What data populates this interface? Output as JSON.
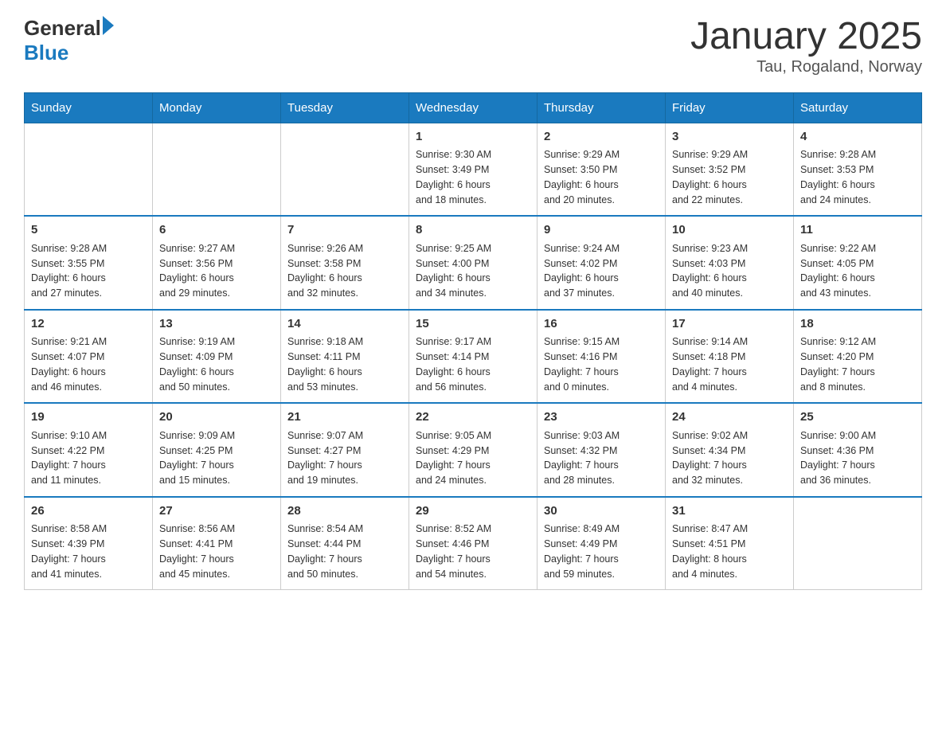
{
  "header": {
    "logo_general": "General",
    "logo_blue": "Blue",
    "month_title": "January 2025",
    "location": "Tau, Rogaland, Norway"
  },
  "days_of_week": [
    "Sunday",
    "Monday",
    "Tuesday",
    "Wednesday",
    "Thursday",
    "Friday",
    "Saturday"
  ],
  "weeks": [
    [
      {
        "day": "",
        "info": ""
      },
      {
        "day": "",
        "info": ""
      },
      {
        "day": "",
        "info": ""
      },
      {
        "day": "1",
        "info": "Sunrise: 9:30 AM\nSunset: 3:49 PM\nDaylight: 6 hours\nand 18 minutes."
      },
      {
        "day": "2",
        "info": "Sunrise: 9:29 AM\nSunset: 3:50 PM\nDaylight: 6 hours\nand 20 minutes."
      },
      {
        "day": "3",
        "info": "Sunrise: 9:29 AM\nSunset: 3:52 PM\nDaylight: 6 hours\nand 22 minutes."
      },
      {
        "day": "4",
        "info": "Sunrise: 9:28 AM\nSunset: 3:53 PM\nDaylight: 6 hours\nand 24 minutes."
      }
    ],
    [
      {
        "day": "5",
        "info": "Sunrise: 9:28 AM\nSunset: 3:55 PM\nDaylight: 6 hours\nand 27 minutes."
      },
      {
        "day": "6",
        "info": "Sunrise: 9:27 AM\nSunset: 3:56 PM\nDaylight: 6 hours\nand 29 minutes."
      },
      {
        "day": "7",
        "info": "Sunrise: 9:26 AM\nSunset: 3:58 PM\nDaylight: 6 hours\nand 32 minutes."
      },
      {
        "day": "8",
        "info": "Sunrise: 9:25 AM\nSunset: 4:00 PM\nDaylight: 6 hours\nand 34 minutes."
      },
      {
        "day": "9",
        "info": "Sunrise: 9:24 AM\nSunset: 4:02 PM\nDaylight: 6 hours\nand 37 minutes."
      },
      {
        "day": "10",
        "info": "Sunrise: 9:23 AM\nSunset: 4:03 PM\nDaylight: 6 hours\nand 40 minutes."
      },
      {
        "day": "11",
        "info": "Sunrise: 9:22 AM\nSunset: 4:05 PM\nDaylight: 6 hours\nand 43 minutes."
      }
    ],
    [
      {
        "day": "12",
        "info": "Sunrise: 9:21 AM\nSunset: 4:07 PM\nDaylight: 6 hours\nand 46 minutes."
      },
      {
        "day": "13",
        "info": "Sunrise: 9:19 AM\nSunset: 4:09 PM\nDaylight: 6 hours\nand 50 minutes."
      },
      {
        "day": "14",
        "info": "Sunrise: 9:18 AM\nSunset: 4:11 PM\nDaylight: 6 hours\nand 53 minutes."
      },
      {
        "day": "15",
        "info": "Sunrise: 9:17 AM\nSunset: 4:14 PM\nDaylight: 6 hours\nand 56 minutes."
      },
      {
        "day": "16",
        "info": "Sunrise: 9:15 AM\nSunset: 4:16 PM\nDaylight: 7 hours\nand 0 minutes."
      },
      {
        "day": "17",
        "info": "Sunrise: 9:14 AM\nSunset: 4:18 PM\nDaylight: 7 hours\nand 4 minutes."
      },
      {
        "day": "18",
        "info": "Sunrise: 9:12 AM\nSunset: 4:20 PM\nDaylight: 7 hours\nand 8 minutes."
      }
    ],
    [
      {
        "day": "19",
        "info": "Sunrise: 9:10 AM\nSunset: 4:22 PM\nDaylight: 7 hours\nand 11 minutes."
      },
      {
        "day": "20",
        "info": "Sunrise: 9:09 AM\nSunset: 4:25 PM\nDaylight: 7 hours\nand 15 minutes."
      },
      {
        "day": "21",
        "info": "Sunrise: 9:07 AM\nSunset: 4:27 PM\nDaylight: 7 hours\nand 19 minutes."
      },
      {
        "day": "22",
        "info": "Sunrise: 9:05 AM\nSunset: 4:29 PM\nDaylight: 7 hours\nand 24 minutes."
      },
      {
        "day": "23",
        "info": "Sunrise: 9:03 AM\nSunset: 4:32 PM\nDaylight: 7 hours\nand 28 minutes."
      },
      {
        "day": "24",
        "info": "Sunrise: 9:02 AM\nSunset: 4:34 PM\nDaylight: 7 hours\nand 32 minutes."
      },
      {
        "day": "25",
        "info": "Sunrise: 9:00 AM\nSunset: 4:36 PM\nDaylight: 7 hours\nand 36 minutes."
      }
    ],
    [
      {
        "day": "26",
        "info": "Sunrise: 8:58 AM\nSunset: 4:39 PM\nDaylight: 7 hours\nand 41 minutes."
      },
      {
        "day": "27",
        "info": "Sunrise: 8:56 AM\nSunset: 4:41 PM\nDaylight: 7 hours\nand 45 minutes."
      },
      {
        "day": "28",
        "info": "Sunrise: 8:54 AM\nSunset: 4:44 PM\nDaylight: 7 hours\nand 50 minutes."
      },
      {
        "day": "29",
        "info": "Sunrise: 8:52 AM\nSunset: 4:46 PM\nDaylight: 7 hours\nand 54 minutes."
      },
      {
        "day": "30",
        "info": "Sunrise: 8:49 AM\nSunset: 4:49 PM\nDaylight: 7 hours\nand 59 minutes."
      },
      {
        "day": "31",
        "info": "Sunrise: 8:47 AM\nSunset: 4:51 PM\nDaylight: 8 hours\nand 4 minutes."
      },
      {
        "day": "",
        "info": ""
      }
    ]
  ]
}
